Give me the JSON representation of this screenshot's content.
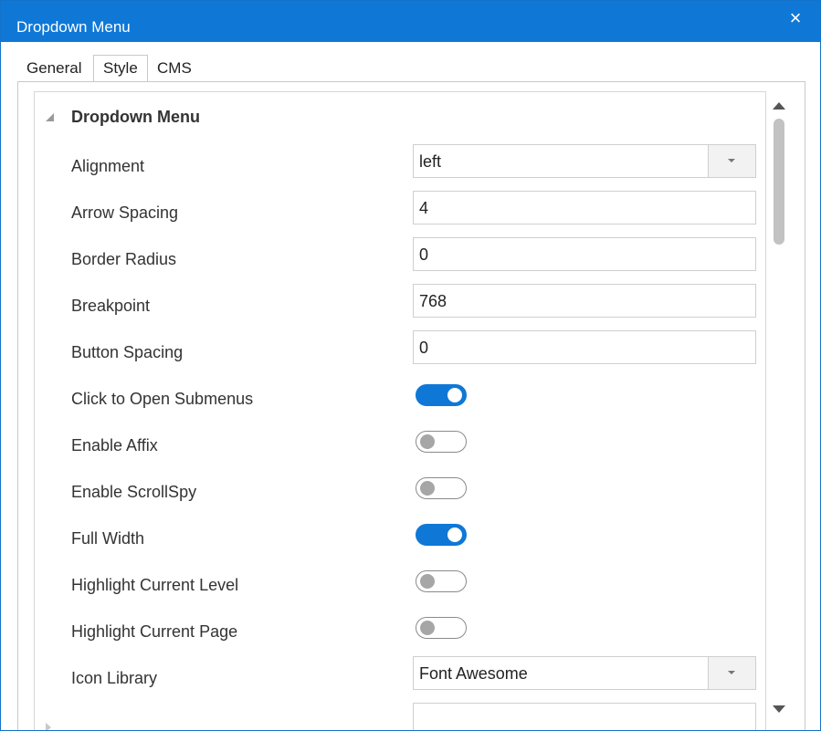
{
  "window": {
    "title": "Dropdown Menu"
  },
  "tabs": [
    {
      "label": "General"
    },
    {
      "label": "Style",
      "active": true
    },
    {
      "label": "CMS"
    }
  ],
  "section": {
    "title": "Dropdown Menu",
    "expanded": true
  },
  "properties": {
    "alignment": {
      "label": "Alignment",
      "value": "left"
    },
    "arrow_spacing": {
      "label": "Arrow Spacing",
      "value": "4"
    },
    "border_radius": {
      "label": "Border Radius",
      "value": "0"
    },
    "breakpoint": {
      "label": "Breakpoint",
      "value": "768"
    },
    "button_spacing": {
      "label": "Button Spacing",
      "value": "0"
    },
    "click_to_open_submenus": {
      "label": "Click to Open Submenus",
      "checked": true
    },
    "enable_affix": {
      "label": "Enable Affix",
      "checked": false
    },
    "enable_scrollspy": {
      "label": "Enable ScrollSpy",
      "checked": false
    },
    "full_width": {
      "label": "Full Width",
      "checked": true
    },
    "highlight_current_level": {
      "label": "Highlight Current Level",
      "checked": false
    },
    "highlight_current_page": {
      "label": "Highlight Current Page",
      "checked": false
    },
    "icon_library": {
      "label": "Icon Library",
      "value": "Font Awesome"
    }
  },
  "colors": {
    "accent": "#0f78d7",
    "title_bar": "#0f78d7"
  }
}
